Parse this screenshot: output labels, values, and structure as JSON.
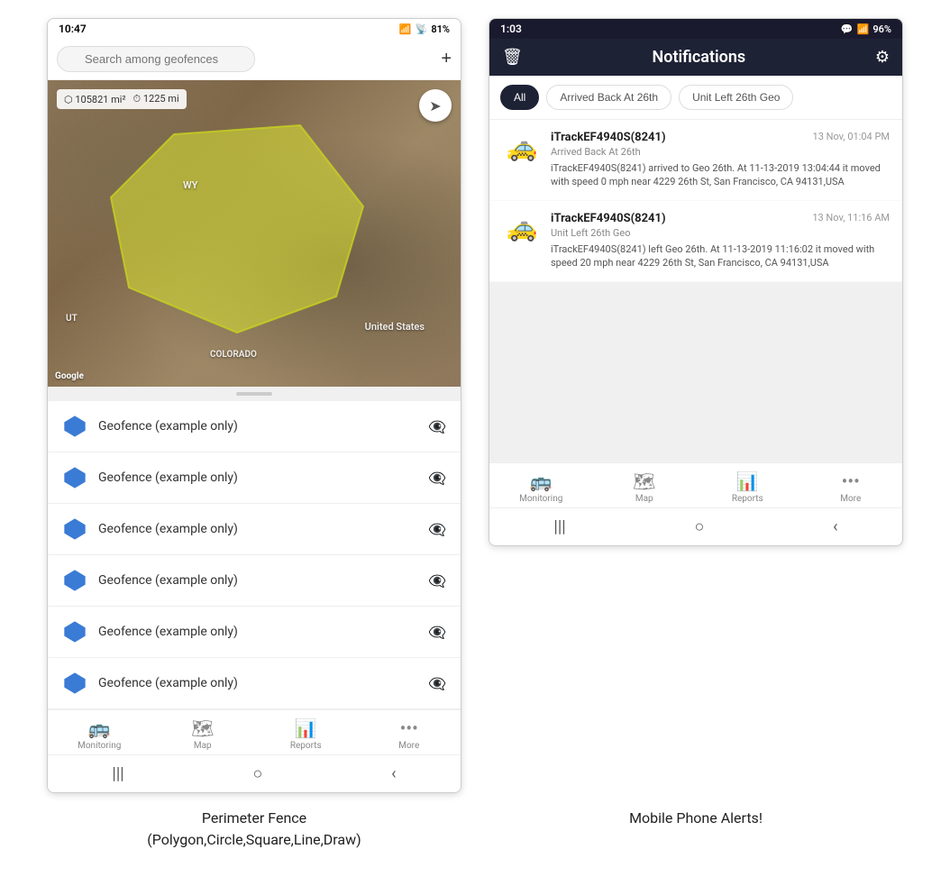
{
  "left_phone": {
    "status_bar": {
      "time": "10:47",
      "battery": "81%",
      "signal": "WiFi + Cell"
    },
    "search": {
      "placeholder": "Search among geofences"
    },
    "map": {
      "stats_area": "105821 mi²",
      "stats_dist": "1225 mi",
      "label_wy": "WY",
      "label_us": "United States",
      "label_co": "COLORADO",
      "label_ut": "UT"
    },
    "geofence_items": [
      {
        "name": "Geofence (example only)"
      },
      {
        "name": "Geofence (example only)"
      },
      {
        "name": "Geofence (example only)"
      },
      {
        "name": "Geofence (example only)"
      },
      {
        "name": "Geofence (example only)"
      },
      {
        "name": "Geofence (example only)"
      }
    ],
    "bottom_nav": [
      {
        "label": "Monitoring",
        "icon": "🚌"
      },
      {
        "label": "Map",
        "icon": "🗺"
      },
      {
        "label": "Reports",
        "icon": "📊"
      },
      {
        "label": "More",
        "icon": "···"
      }
    ],
    "caption": "Perimeter Fence\n(Polygon,Circle,Square,Line,Draw)"
  },
  "right_phone": {
    "status_bar": {
      "time": "1:03",
      "battery": "96%"
    },
    "header": {
      "title": "Notifications",
      "delete_label": "🗑",
      "settings_label": "⚙"
    },
    "tabs": [
      {
        "label": "All",
        "active": true
      },
      {
        "label": "Arrived Back At 26th",
        "active": false
      },
      {
        "label": "Unit Left 26th Geo",
        "active": false
      }
    ],
    "notifications": [
      {
        "device": "iTrackEF4940S(8241)",
        "time": "13 Nov, 01:04 PM",
        "event_type": "Arrived Back At 26th",
        "message": "iTrackEF4940S(8241) arrived to Geo 26th.    At 11-13-2019 13:04:44 it moved with speed 0 mph near 4229 26th St, San Francisco, CA 94131,USA"
      },
      {
        "device": "iTrackEF4940S(8241)",
        "time": "13 Nov, 11:16 AM",
        "event_type": "Unit Left 26th Geo",
        "message": "iTrackEF4940S(8241) left Geo 26th.    At 11-13-2019 11:16:02 it moved with speed 20 mph near 4229 26th St, San Francisco, CA 94131,USA"
      }
    ],
    "bottom_nav": [
      {
        "label": "Monitoring",
        "icon": "🚌"
      },
      {
        "label": "Map",
        "icon": "🗺"
      },
      {
        "label": "Reports",
        "icon": "📊"
      },
      {
        "label": "More",
        "icon": "···"
      }
    ],
    "caption": "Mobile Phone Alerts!"
  }
}
